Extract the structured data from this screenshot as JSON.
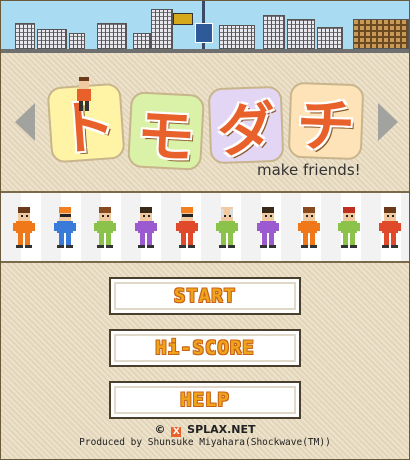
{
  "title": {
    "tiles": [
      "ト",
      "モ",
      "ダ",
      "チ"
    ],
    "tagline": "make friends!"
  },
  "nav": {
    "prev_icon": "triangle-left-icon",
    "next_icon": "triangle-right-icon"
  },
  "characters": [
    {
      "hair": "#6b3a1a",
      "shirt": "#f07818",
      "pants": "#f07818",
      "shades": false,
      "face": "front"
    },
    {
      "hair": "#f08020",
      "shirt": "#3a7ad8",
      "pants": "#3a7ad8",
      "shades": true,
      "face": "side"
    },
    {
      "hair": "#8a4a20",
      "shirt": "#8bc34a",
      "pants": "#8bc34a",
      "shades": false,
      "face": "front"
    },
    {
      "hair": "#3a2a1a",
      "shirt": "#9b5ad0",
      "pants": "#9b5ad0",
      "shades": false,
      "face": "side"
    },
    {
      "hair": "#f08020",
      "shirt": "#e04a2a",
      "pants": "#e04a2a",
      "shades": true,
      "face": "side"
    },
    {
      "hair": "#ffffff",
      "shirt": "#8bc34a",
      "pants": "#8bc34a",
      "shades": false,
      "face": "bald"
    },
    {
      "hair": "#3a2a1a",
      "shirt": "#9b5ad0",
      "pants": "#9b5ad0",
      "shades": false,
      "face": "front"
    },
    {
      "hair": "#8a4a20",
      "shirt": "#f07818",
      "pants": "#f07818",
      "shades": false,
      "face": "front"
    },
    {
      "hair": "#c03020",
      "shirt": "#8bc34a",
      "pants": "#8bc34a",
      "shades": false,
      "face": "side"
    },
    {
      "hair": "#6b3a1a",
      "shirt": "#e04a2a",
      "pants": "#e04a2a",
      "shades": false,
      "face": "front"
    }
  ],
  "menu": {
    "start": "START",
    "hiscore": "Hi-SCORE",
    "help": "HELP"
  },
  "footer": {
    "copyright": "©",
    "logo_mark": "X",
    "site": "SPLAX.NET",
    "credit": "Produced by Shunsuke Miyahara(Shockwave(TM))"
  },
  "colors": {
    "accent": "#e8612a",
    "button_text": "#f0a418",
    "background": "#e9dcc0"
  }
}
